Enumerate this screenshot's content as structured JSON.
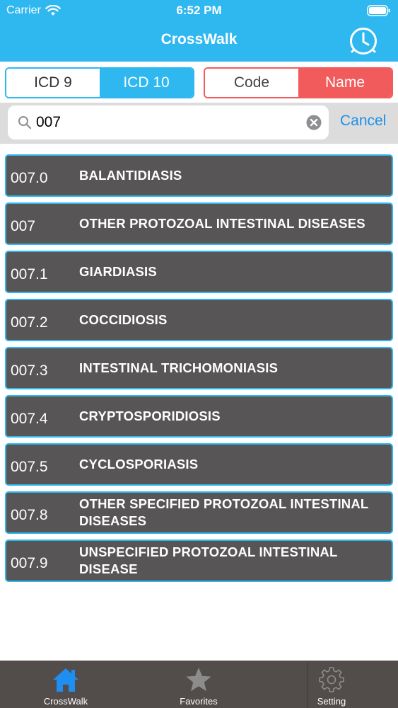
{
  "status_bar": {
    "carrier": "Carrier",
    "time": "6:52 PM"
  },
  "nav": {
    "title": "CrossWalk",
    "history_icon": "clock-icon"
  },
  "code_system_segment": {
    "options": [
      "ICD 9",
      "ICD 10"
    ],
    "selected": "ICD 10"
  },
  "search_mode_segment": {
    "options": [
      "Code",
      "Name"
    ],
    "selected": "Name"
  },
  "search": {
    "value": "007",
    "placeholder": "",
    "cancel_label": "Cancel"
  },
  "results": [
    {
      "code": "007.0",
      "name": "BALANTIDIASIS"
    },
    {
      "code": "007",
      "name": "OTHER PROTOZOAL INTESTINAL DISEASES"
    },
    {
      "code": "007.1",
      "name": "GIARDIASIS"
    },
    {
      "code": "007.2",
      "name": "COCCIDIOSIS"
    },
    {
      "code": "007.3",
      "name": "INTESTINAL TRICHOMONIASIS"
    },
    {
      "code": "007.4",
      "name": "CRYPTOSPORIDIOSIS"
    },
    {
      "code": "007.5",
      "name": "CYCLOSPORIASIS"
    },
    {
      "code": "007.8",
      "name": "OTHER SPECIFIED PROTOZOAL INTESTINAL DISEASES"
    },
    {
      "code": "007.9",
      "name": "UNSPECIFIED PROTOZOAL INTESTINAL DISEASE"
    }
  ],
  "tabbar": {
    "tabs": [
      {
        "label": "CrossWalk",
        "icon": "home-icon",
        "active": true
      },
      {
        "label": "Favorites",
        "icon": "star-icon",
        "active": false
      },
      {
        "label": "Setting",
        "icon": "gear-icon",
        "active": false
      }
    ]
  },
  "colors": {
    "header": "#2eb8ef",
    "code_segment_accent": "#2eb8ef",
    "mode_segment_accent": "#f25b5b",
    "row_background": "#575556",
    "tab_active": "#1e8ef0",
    "cancel": "#1e90e8"
  }
}
